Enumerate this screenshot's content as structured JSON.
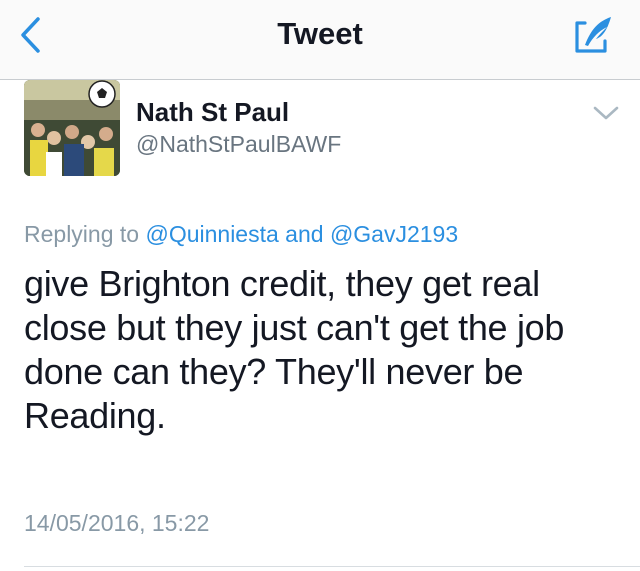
{
  "nav": {
    "title": "Tweet",
    "back_icon": "chevron-left-icon",
    "compose_icon": "compose-quill-icon",
    "accent_color": "#1d9bf0"
  },
  "tweet": {
    "author": {
      "display_name": "Nath St Paul",
      "handle": "@NathStPaulBAWF"
    },
    "replying_prefix": "Replying to",
    "reply_to": [
      "@Quinniesta",
      "@GavJ2193"
    ],
    "reply_joiner": "and",
    "text_lines": [
      "give Brighton credit, they get real",
      "close but they just can't get the job",
      "done can they? They'll never be",
      "Reading."
    ],
    "timestamp": "14/05/2016, 15:22"
  }
}
